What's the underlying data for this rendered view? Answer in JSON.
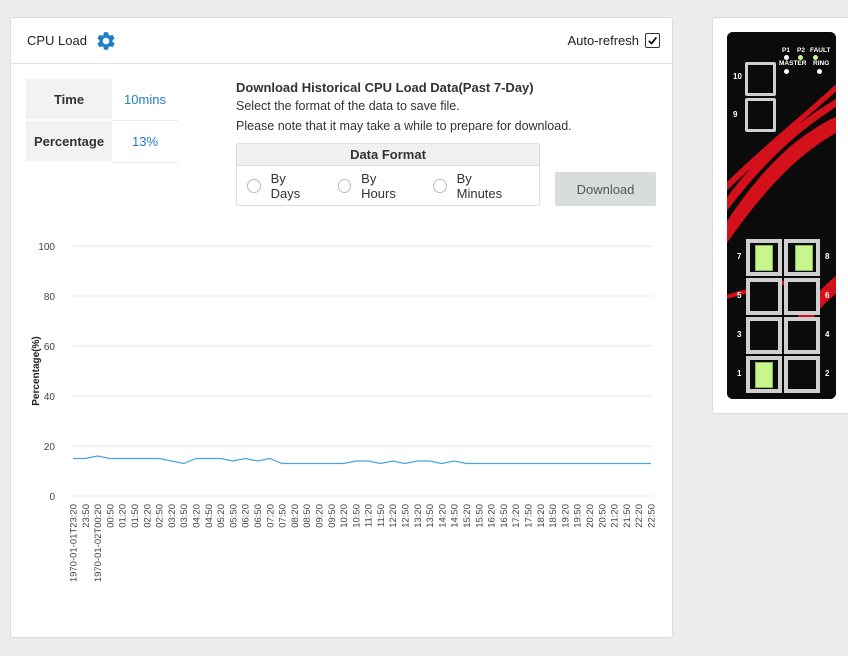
{
  "card": {
    "title": "CPU Load",
    "auto_refresh_label": "Auto-refresh",
    "auto_refresh_checked": true
  },
  "stats": {
    "time_label": "Time",
    "time_value": "10mins",
    "percentage_label": "Percentage",
    "percentage_value": "13%"
  },
  "download": {
    "title": "Download Historical CPU Load Data(Past 7-Day)",
    "line1": "Select the format of the data to save file.",
    "line2": "Please note that it may take a while to prepare for download.",
    "format_title": "Data Format",
    "options": [
      "By Days",
      "By Hours",
      "By Minutes"
    ],
    "button_label": "Download"
  },
  "colors": {
    "accent": "#1f7fc4",
    "line": "#4aa3df",
    "button": "#d8dcdc",
    "led_green": "#c8f58c",
    "red_wave": "#d4111b"
  },
  "device": {
    "led_labels": [
      "P1",
      "P2",
      "FAULT"
    ],
    "led_labels2": [
      "MASTER",
      "RING"
    ],
    "sfp_ports": [
      "10",
      "9"
    ],
    "ports": [
      {
        "left": "7",
        "right": "8",
        "left_active": true,
        "right_active": true
      },
      {
        "left": "5",
        "right": "6",
        "left_active": false,
        "right_active": false
      },
      {
        "left": "3",
        "right": "4",
        "left_active": false,
        "right_active": false
      },
      {
        "left": "1",
        "right": "2",
        "left_active": true,
        "right_active": false
      }
    ]
  },
  "chart_data": {
    "type": "line",
    "title": "",
    "xlabel": "",
    "ylabel": "Percentage(%)",
    "ylim": [
      0,
      100
    ],
    "yticks": [
      0,
      20,
      40,
      60,
      80,
      100
    ],
    "grid": true,
    "x": [
      "1970-01-01T23:20",
      "23:50",
      "1970-01-02T00:20",
      "00:50",
      "01:20",
      "01:50",
      "02:20",
      "02:50",
      "03:20",
      "03:50",
      "04:20",
      "04:50",
      "05:20",
      "05:50",
      "06:20",
      "06:50",
      "07:20",
      "07:50",
      "08:20",
      "08:50",
      "09:20",
      "09:50",
      "10:20",
      "10:50",
      "11:20",
      "11:50",
      "12:20",
      "12:50",
      "13:20",
      "13:50",
      "14:20",
      "14:50",
      "15:20",
      "15:50",
      "16:20",
      "16:50",
      "17:20",
      "17:50",
      "18:20",
      "18:50",
      "19:20",
      "19:50",
      "20:20",
      "20:50",
      "21:20",
      "21:50",
      "22:20",
      "22:50"
    ],
    "series": [
      {
        "values": [
          15,
          15,
          16,
          15,
          15,
          15,
          15,
          15,
          14,
          13,
          15,
          15,
          15,
          14,
          15,
          14,
          15,
          13,
          13,
          13,
          13,
          13,
          13,
          14,
          14,
          13,
          14,
          13,
          14,
          14,
          13,
          14,
          13,
          13,
          13,
          13,
          13,
          13,
          13,
          13,
          13,
          13,
          13,
          13,
          13,
          13,
          13,
          13
        ]
      }
    ]
  }
}
